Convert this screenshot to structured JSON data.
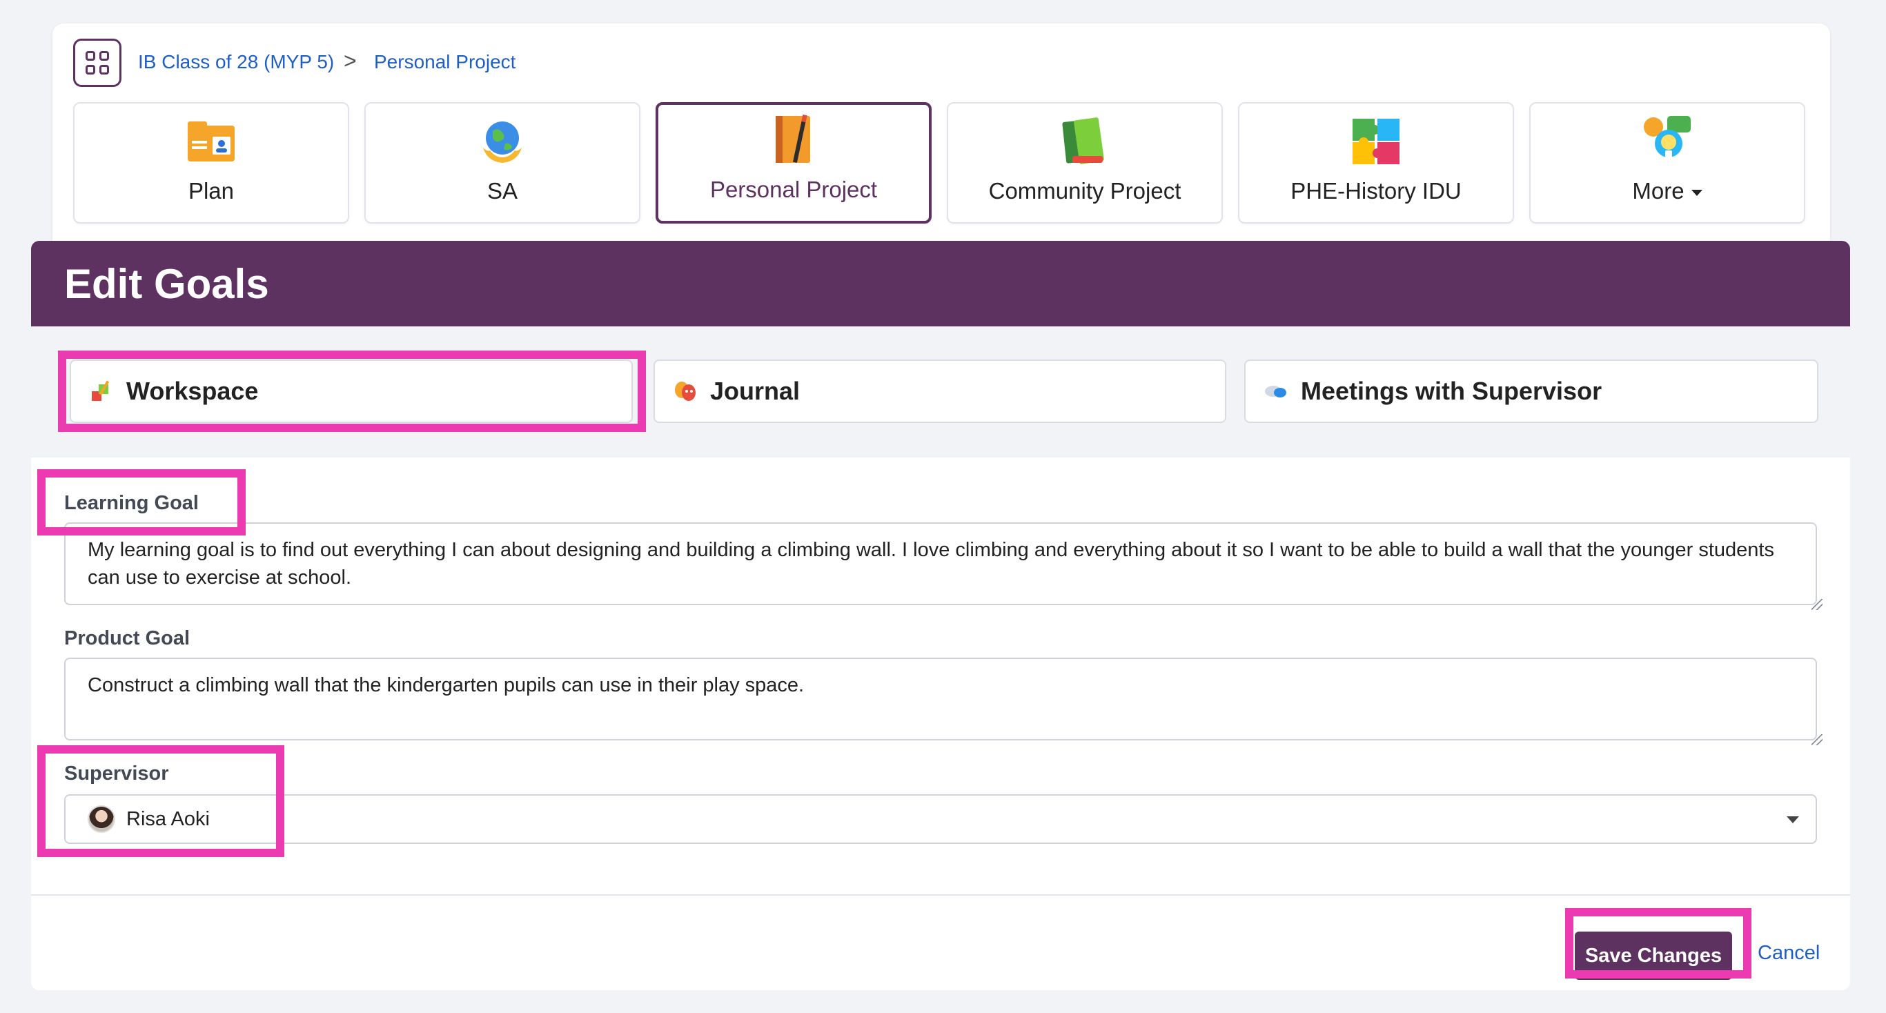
{
  "breadcrumb": {
    "parent": "IB Class of 28 (MYP 5)",
    "separator": ">",
    "current": "Personal Project"
  },
  "tiles": [
    {
      "label": "Plan",
      "icon": "folder-id-icon",
      "active": false
    },
    {
      "label": "SA",
      "icon": "globe-hands-icon",
      "active": false
    },
    {
      "label": "Personal Project",
      "icon": "notebook-pencil-icon",
      "active": true
    },
    {
      "label": "Community Project",
      "icon": "books-icon",
      "active": false
    },
    {
      "label": "PHE-History IDU",
      "icon": "puzzle-icon",
      "active": false
    },
    {
      "label": "More",
      "icon": "lightbulb-chat-icon",
      "active": false
    }
  ],
  "header": {
    "title": "Edit Goals"
  },
  "subnav": [
    {
      "label": "Workspace",
      "icon": "workspace-icon"
    },
    {
      "label": "Journal",
      "icon": "theater-masks-icon"
    },
    {
      "label": "Meetings with Supervisor",
      "icon": "chat-bubbles-icon"
    }
  ],
  "form": {
    "learning_goal_label": "Learning Goal",
    "learning_goal_value": "My learning goal is to find out everything I can about designing and building a climbing wall. I love climbing and everything about it so I want to be able to build a wall that the younger students can use to exercise at school.",
    "product_goal_label": "Product Goal",
    "product_goal_value": "Construct a climbing wall that the kindergarten pupils can use in their play space.",
    "supervisor_label": "Supervisor",
    "supervisor_value": "Risa Aoki"
  },
  "actions": {
    "save_label": "Save Changes",
    "cancel_label": "Cancel"
  },
  "colors": {
    "brand": "#5d3160",
    "link": "#1f5fc4",
    "annotation": "#ec3ab0"
  }
}
